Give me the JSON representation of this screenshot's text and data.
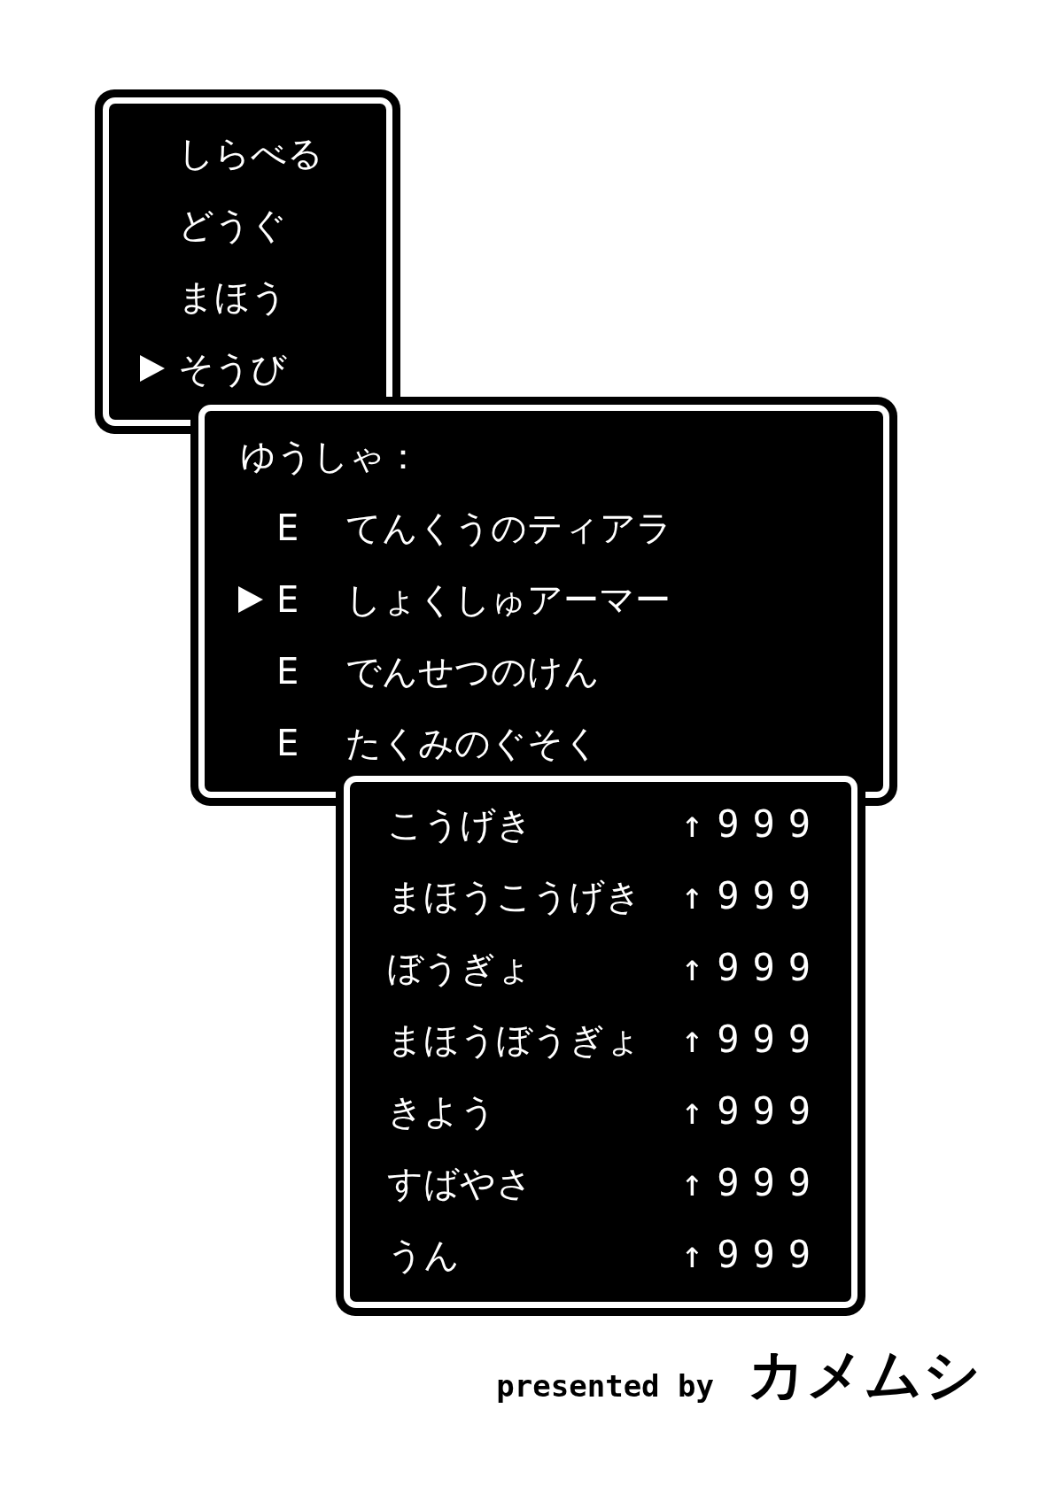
{
  "command_menu": {
    "items": [
      {
        "label": "しらべる",
        "selected": false
      },
      {
        "label": "どうぐ",
        "selected": false
      },
      {
        "label": "まほう",
        "selected": false
      },
      {
        "label": "そうび",
        "selected": true
      }
    ]
  },
  "equipment": {
    "character": "ゆうしゃ：",
    "items": [
      {
        "mark": "E",
        "name": "てんくうのティアラ",
        "selected": false
      },
      {
        "mark": "E",
        "name": "しょくしゅアーマー",
        "selected": true
      },
      {
        "mark": "E",
        "name": "でんせつのけん",
        "selected": false
      },
      {
        "mark": "E",
        "name": "たくみのぐそく",
        "selected": false
      }
    ]
  },
  "stats": {
    "rows": [
      {
        "label": "こうげき",
        "value": "↑999"
      },
      {
        "label": "まほうこうげき",
        "value": "↑999"
      },
      {
        "label": "ぼうぎょ",
        "value": "↑999"
      },
      {
        "label": "まほうぼうぎょ",
        "value": "↑999"
      },
      {
        "label": "きよう",
        "value": "↑999"
      },
      {
        "label": "すばやさ",
        "value": "↑999"
      },
      {
        "label": "うん",
        "value": "↑999"
      }
    ]
  },
  "footer": {
    "credit": "presented by",
    "author": "カメムシ"
  }
}
